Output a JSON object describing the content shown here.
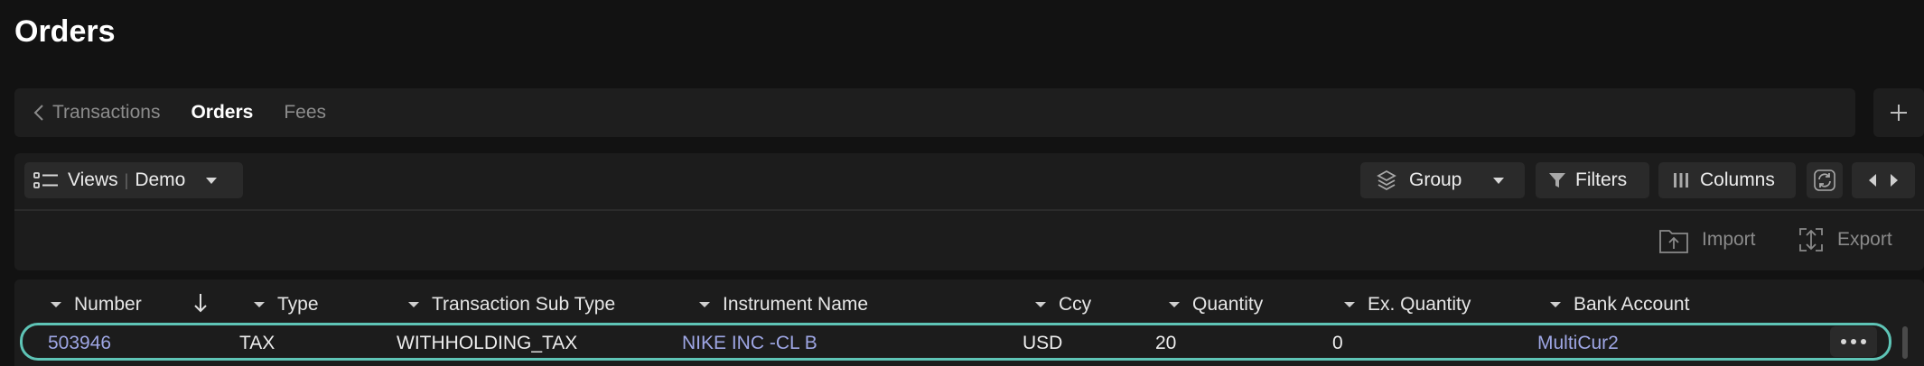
{
  "page": {
    "title": "Orders"
  },
  "tabs": {
    "back_label": "Transactions",
    "items": [
      {
        "label": "Orders",
        "active": true
      },
      {
        "label": "Fees",
        "active": false
      }
    ]
  },
  "toolbar": {
    "views_label": "Views",
    "views_separator": "|",
    "view_name": "Demo",
    "group_label": "Group",
    "filters_label": "Filters",
    "columns_label": "Columns",
    "import_label": "Import",
    "export_label": "Export"
  },
  "grid": {
    "columns": [
      "Number",
      "Type",
      "Transaction Sub Type",
      "Instrument Name",
      "Ccy",
      "Quantity",
      "Ex. Quantity",
      "Bank Account"
    ],
    "sort": {
      "column": "Number",
      "direction": "descending",
      "icon": "arrow-down-icon"
    },
    "rows": [
      {
        "number": "503946",
        "type": "TAX",
        "sub_type": "WITHHOLDING_TAX",
        "instrument": "NIKE INC -CL B",
        "ccy": "USD",
        "quantity": "20",
        "ex_quantity": "0",
        "bank_account": "MultiCur2"
      }
    ]
  },
  "colors": {
    "background": "#121212",
    "panel": "#1c1c1c",
    "button": "#2a2a2a",
    "link": "#9ea6e4",
    "selected_row_border": "#5ec4b6",
    "muted_text": "#8a8a8a"
  },
  "icons": {
    "back": "chevron-left-icon",
    "add": "plus-icon",
    "views": "list-icon",
    "group": "layers-icon",
    "filters": "filter-icon",
    "columns": "columns-icon",
    "refresh": "refresh-icon",
    "nav": "arrows-left-right-icon",
    "import": "folder-upload-icon",
    "export": "export-icon",
    "row_menu": "more-horizontal-icon"
  }
}
